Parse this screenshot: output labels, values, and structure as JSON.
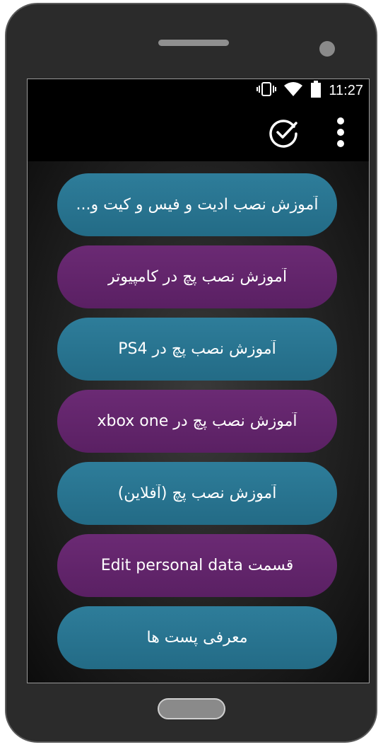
{
  "status_bar": {
    "time": "11:27",
    "icons": [
      "vibrate-icon",
      "wifi-icon",
      "battery-icon"
    ]
  },
  "app_bar": {
    "actions": [
      "check-circle-icon",
      "more-vert-icon"
    ]
  },
  "menu": {
    "items": [
      {
        "label": "آموزش نصب ادیت و فیس و کیت و...",
        "color": "#2e7d9a"
      },
      {
        "label": "آموزش نصب پچ در کامپیوتر",
        "color": "#6b2a74"
      },
      {
        "label": "آموزش نصب پچ در PS4",
        "color": "#2e7d9a"
      },
      {
        "label": "آموزش نصب پچ در xbox one",
        "color": "#6b2a74"
      },
      {
        "label": "آموزش نصب پچ  (آفلاین)",
        "color": "#2e7d9a"
      },
      {
        "label": "قسمت Edit personal data",
        "color": "#6b2a74"
      },
      {
        "label": "معرفی پست ها",
        "color": "#2e7d9a"
      }
    ]
  },
  "colors": {
    "blue_button": "#2e7d9a",
    "purple_button": "#6b2a74",
    "status_bar": "#000000",
    "phone_body": "#2b2b2b"
  }
}
